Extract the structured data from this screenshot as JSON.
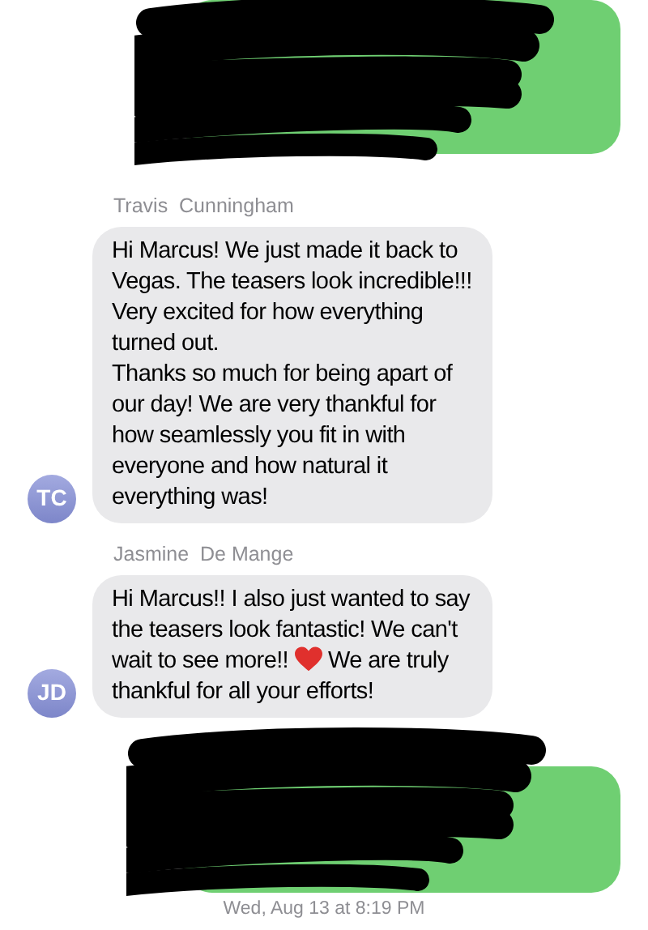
{
  "messages": [
    {
      "kind": "redacted_outgoing"
    },
    {
      "kind": "incoming",
      "sender": "Travis  Cunningham",
      "initials": "TC",
      "parts": [
        {
          "kind": "text",
          "text": "Hi Marcus! We just made it back to Vegas. The teasers look incredible!!! Very excited for how everything turned out.\nThanks so much for being apart of our day! We are very thankful for how seamlessly you fit in with everyone and how natural it everything was!"
        }
      ]
    },
    {
      "kind": "incoming",
      "sender": "Jasmine  De Mange",
      "initials": "JD",
      "parts": [
        {
          "kind": "text",
          "text": "Hi Marcus!! I also just wanted to say the teasers look fantastic! We can't wait to see more!! "
        },
        {
          "kind": "heart"
        },
        {
          "kind": "text",
          "text": " We are truly thankful for all your efforts!"
        }
      ]
    },
    {
      "kind": "redacted_outgoing"
    },
    {
      "kind": "timestamp",
      "text": "Wed, Aug 13 at 8:19 PM"
    }
  ]
}
